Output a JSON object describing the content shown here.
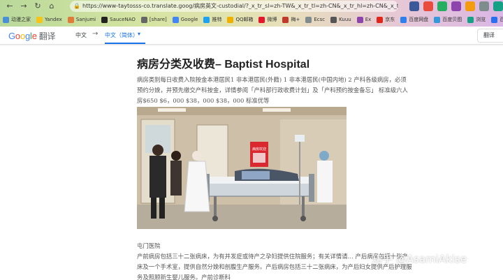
{
  "browser": {
    "url": "https://www-taytosss-co.translate.goog/病房英文-custodial/?_x_tr_sl=zh-TW&_x_tr_tl=zh-CN&_x_tr_hl=zh-CN&_x_tr_pto=sc",
    "bookmarks": [
      {
        "label": "动漫之家",
        "color": "#4a90d9"
      },
      {
        "label": "Yandex",
        "color": "#f5c518"
      },
      {
        "label": "Sanjumi",
        "color": "#e07b39"
      },
      {
        "label": "SauceNAO",
        "color": "#222222"
      },
      {
        "label": "[share]",
        "color": "#666666"
      },
      {
        "label": "Google",
        "color": "#4285f4"
      },
      {
        "label": "推特",
        "color": "#1da1f2"
      },
      {
        "label": "QQ邮箱",
        "color": "#f0b000"
      },
      {
        "label": "微博",
        "color": "#e6162d"
      },
      {
        "label": "梅+",
        "color": "#c0392b"
      },
      {
        "label": "Ecsc",
        "color": "#7f8c8d"
      },
      {
        "label": "Kuuu",
        "color": "#555555"
      },
      {
        "label": "Ex",
        "color": "#8e44ad"
      },
      {
        "label": "京东",
        "color": "#e1251b"
      },
      {
        "label": "百度网盘",
        "color": "#2f80ed"
      },
      {
        "label": "百度贝图",
        "color": "#3498db"
      },
      {
        "label": "浏览",
        "color": "#16a085"
      },
      {
        "label": "百度翻译",
        "color": "#2a6ff0"
      }
    ]
  },
  "translate_bar": {
    "logo_google": "Google",
    "logo_product": "翻译",
    "source_lang": "中文",
    "arrow": "→",
    "target_lang": "中文（简体）",
    "caret": "▾",
    "translate_button": "翻译"
  },
  "article": {
    "title": "病房分类及收费– Baptist Hospital",
    "paragraph1": "病房类别每日收费入院按金本港居民1 非本港居民(外籍) 1 非本港居民(中国内地) 2 产科各级病房，必须预约分娩，并预先缴交产科按金，详情参阅「产科部行政收费计划」及「产科预约按金备忘」 标准级六人房$650 $6，000 $38，000 $38，000 标准优等",
    "paragraph2_line1": "屯门医院",
    "paragraph2_line2": "产前病房包括三十二张病床，为有并发症或待产之孕妇提供住院服务；有关详情请… 产后病房包括十张产床及一个手术室，提供自然分娩和剖腹生产服务。产后病房包括三十二张病床，为产后妇女提供产后护理服务及照顾新生婴儿服务。产前诊断科"
  },
  "photo_sign": "病房欢迎",
  "watermark": "知乎 @AsamiAkise"
}
